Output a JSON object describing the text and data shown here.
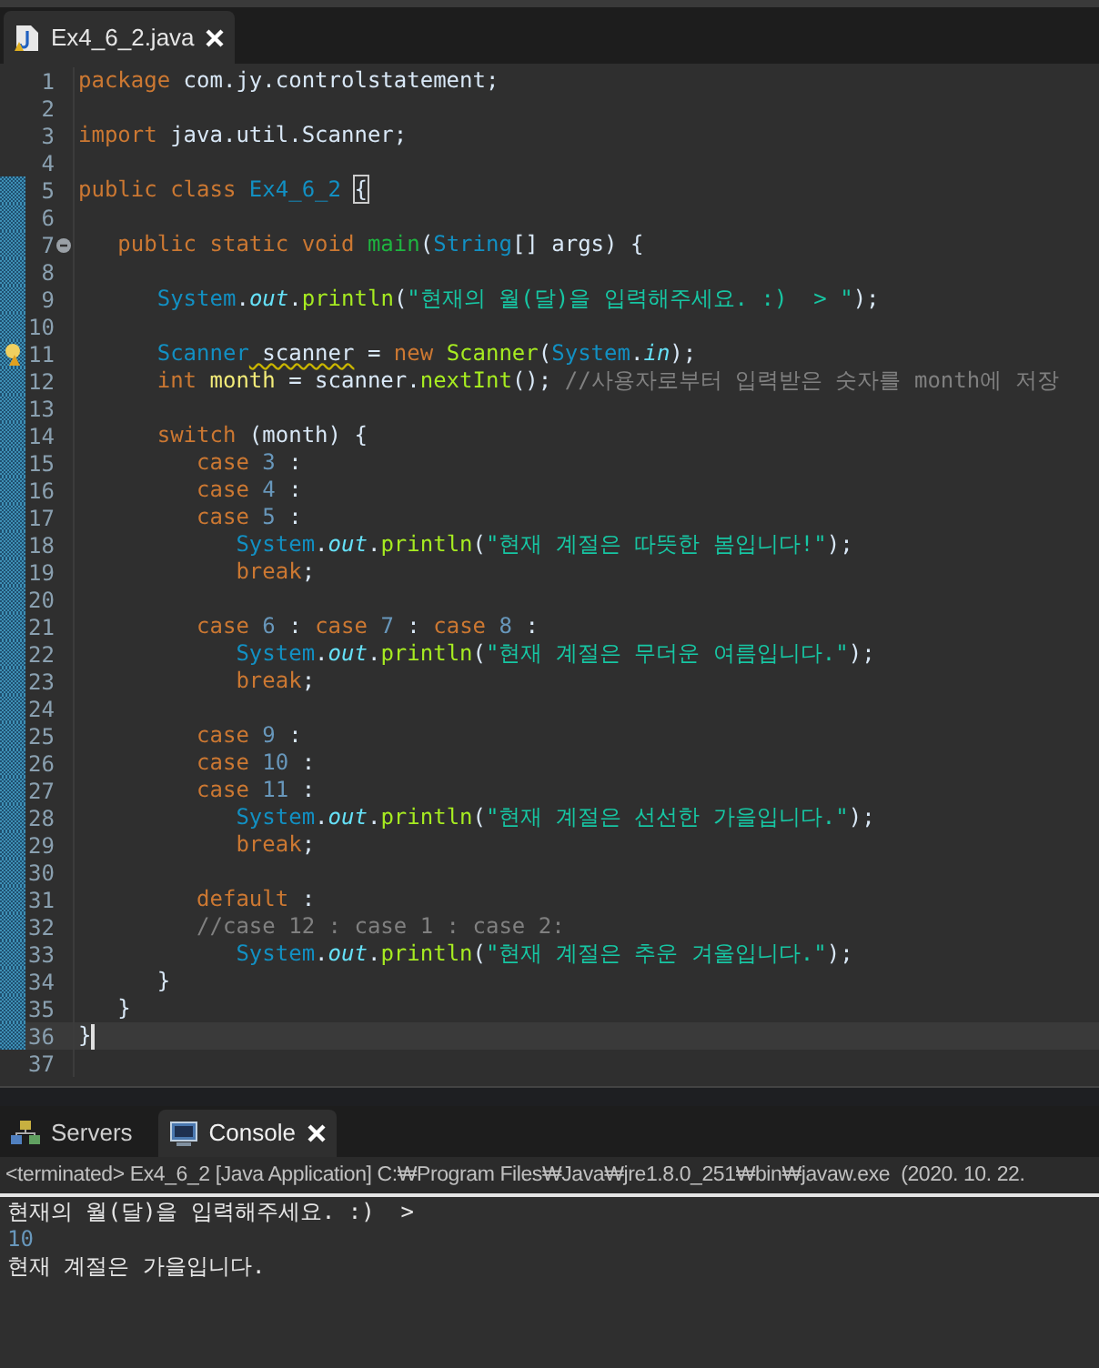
{
  "editor": {
    "tabs": [
      {
        "label": "Ex4_6_2.java",
        "selected": true
      }
    ],
    "lines": [
      {
        "number": "1",
        "kind": "plain",
        "annotated": false,
        "current": false,
        "tokens": [
          {
            "kind": "keyword",
            "text": "package"
          },
          {
            "kind": "plain",
            "text": " com.jy.controlstatement;"
          }
        ]
      },
      {
        "number": "2",
        "kind": "plain",
        "annotated": false,
        "current": false
      },
      {
        "number": "3",
        "kind": "plain",
        "annotated": false,
        "current": false,
        "tokens": [
          {
            "kind": "keyword",
            "text": "import"
          },
          {
            "kind": "plain",
            "text": " java.util.Scanner;"
          }
        ]
      },
      {
        "number": "4",
        "kind": "plain",
        "annotated": false,
        "current": false
      },
      {
        "number": "5",
        "kind": "plain",
        "annotated": true,
        "current": false,
        "tokens": [
          {
            "kind": "keyword",
            "text": "public class "
          },
          {
            "kind": "type",
            "text": "Ex4_6_2 "
          },
          {
            "kind": "bracket",
            "text": "{"
          }
        ]
      },
      {
        "number": "6",
        "kind": "plain",
        "annotated": true,
        "current": false
      },
      {
        "number": "7",
        "kind": "fold",
        "annotated": true,
        "current": false,
        "tokens": [
          {
            "kind": "keyword",
            "text": "   public static void "
          },
          {
            "kind": "method_decl",
            "text": "main"
          },
          {
            "kind": "plain",
            "text": "("
          },
          {
            "kind": "type",
            "text": "String"
          },
          {
            "kind": "plain",
            "text": "[] args) {"
          }
        ]
      },
      {
        "number": "8",
        "kind": "plain",
        "annotated": true,
        "current": false
      },
      {
        "number": "9",
        "kind": "plain",
        "annotated": true,
        "current": false,
        "tokens": [
          {
            "kind": "type",
            "text": "      System"
          },
          {
            "kind": "plain",
            "text": "."
          },
          {
            "kind": "field",
            "text": "out"
          },
          {
            "kind": "plain",
            "text": "."
          },
          {
            "kind": "method",
            "text": "println"
          },
          {
            "kind": "plain",
            "text": "("
          },
          {
            "kind": "string",
            "text": "\"현재의 월(달)을 입력해주세요. :)  > \""
          },
          {
            "kind": "plain",
            "text": ");"
          }
        ]
      },
      {
        "number": "10",
        "kind": "plain",
        "annotated": true,
        "current": false
      },
      {
        "number": "11",
        "kind": "warning",
        "annotated": true,
        "current": false,
        "tokens": [
          {
            "kind": "type",
            "text": "      Scanner"
          },
          {
            "kind": "warning",
            "text": " scanner"
          },
          {
            "kind": "plain",
            "text": " = "
          },
          {
            "kind": "keyword",
            "text": "new "
          },
          {
            "kind": "method",
            "text": "Scanner"
          },
          {
            "kind": "plain",
            "text": "("
          },
          {
            "kind": "type",
            "text": "System"
          },
          {
            "kind": "plain",
            "text": "."
          },
          {
            "kind": "field",
            "text": "in"
          },
          {
            "kind": "plain",
            "text": ");"
          }
        ]
      },
      {
        "number": "12",
        "kind": "plain",
        "annotated": true,
        "current": false,
        "tokens": [
          {
            "kind": "keyword",
            "text": "      int "
          },
          {
            "kind": "variable",
            "text": "month"
          },
          {
            "kind": "plain",
            "text": " = scanner."
          },
          {
            "kind": "method",
            "text": "nextInt"
          },
          {
            "kind": "plain",
            "text": "(); "
          },
          {
            "kind": "comment",
            "text": "//사용자로부터 입력받은 숫자를 month에 저장"
          }
        ]
      },
      {
        "number": "13",
        "kind": "plain",
        "annotated": true,
        "current": false
      },
      {
        "number": "14",
        "kind": "plain",
        "annotated": true,
        "current": false,
        "tokens": [
          {
            "kind": "keyword",
            "text": "      switch"
          },
          {
            "kind": "plain",
            "text": " (month) {"
          }
        ]
      },
      {
        "number": "15",
        "kind": "plain",
        "annotated": true,
        "current": false,
        "tokens": [
          {
            "kind": "keyword",
            "text": "         case "
          },
          {
            "kind": "number",
            "text": "3"
          },
          {
            "kind": "plain",
            "text": " :"
          }
        ]
      },
      {
        "number": "16",
        "kind": "plain",
        "annotated": true,
        "current": false,
        "tokens": [
          {
            "kind": "keyword",
            "text": "         case "
          },
          {
            "kind": "number",
            "text": "4"
          },
          {
            "kind": "plain",
            "text": " :"
          }
        ]
      },
      {
        "number": "17",
        "kind": "plain",
        "annotated": true,
        "current": false,
        "tokens": [
          {
            "kind": "keyword",
            "text": "         case "
          },
          {
            "kind": "number",
            "text": "5"
          },
          {
            "kind": "plain",
            "text": " :"
          }
        ]
      },
      {
        "number": "18",
        "kind": "plain",
        "annotated": true,
        "current": false,
        "tokens": [
          {
            "kind": "type",
            "text": "            System"
          },
          {
            "kind": "plain",
            "text": "."
          },
          {
            "kind": "field",
            "text": "out"
          },
          {
            "kind": "plain",
            "text": "."
          },
          {
            "kind": "method",
            "text": "println"
          },
          {
            "kind": "plain",
            "text": "("
          },
          {
            "kind": "string",
            "text": "\"현재 계절은 따뜻한 봄입니다!\""
          },
          {
            "kind": "plain",
            "text": ");"
          }
        ]
      },
      {
        "number": "19",
        "kind": "plain",
        "annotated": true,
        "current": false,
        "tokens": [
          {
            "kind": "keyword",
            "text": "            break"
          },
          {
            "kind": "plain",
            "text": ";"
          }
        ]
      },
      {
        "number": "20",
        "kind": "plain",
        "annotated": true,
        "current": false
      },
      {
        "number": "21",
        "kind": "plain",
        "annotated": true,
        "current": false,
        "tokens": [
          {
            "kind": "keyword",
            "text": "         case "
          },
          {
            "kind": "number",
            "text": "6"
          },
          {
            "kind": "plain",
            "text": " : "
          },
          {
            "kind": "keyword",
            "text": "case "
          },
          {
            "kind": "number",
            "text": "7"
          },
          {
            "kind": "plain",
            "text": " : "
          },
          {
            "kind": "keyword",
            "text": "case "
          },
          {
            "kind": "number",
            "text": "8"
          },
          {
            "kind": "plain",
            "text": " :"
          }
        ]
      },
      {
        "number": "22",
        "kind": "plain",
        "annotated": true,
        "current": false,
        "tokens": [
          {
            "kind": "type",
            "text": "            System"
          },
          {
            "kind": "plain",
            "text": "."
          },
          {
            "kind": "field",
            "text": "out"
          },
          {
            "kind": "plain",
            "text": "."
          },
          {
            "kind": "method",
            "text": "println"
          },
          {
            "kind": "plain",
            "text": "("
          },
          {
            "kind": "string",
            "text": "\"현재 계절은 무더운 여름입니다.\""
          },
          {
            "kind": "plain",
            "text": ");"
          }
        ]
      },
      {
        "number": "23",
        "kind": "plain",
        "annotated": true,
        "current": false,
        "tokens": [
          {
            "kind": "keyword",
            "text": "            break"
          },
          {
            "kind": "plain",
            "text": ";"
          }
        ]
      },
      {
        "number": "24",
        "kind": "plain",
        "annotated": true,
        "current": false
      },
      {
        "number": "25",
        "kind": "plain",
        "annotated": true,
        "current": false,
        "tokens": [
          {
            "kind": "keyword",
            "text": "         case "
          },
          {
            "kind": "number",
            "text": "9"
          },
          {
            "kind": "plain",
            "text": " :"
          }
        ]
      },
      {
        "number": "26",
        "kind": "plain",
        "annotated": true,
        "current": false,
        "tokens": [
          {
            "kind": "keyword",
            "text": "         case "
          },
          {
            "kind": "number",
            "text": "10"
          },
          {
            "kind": "plain",
            "text": " :"
          }
        ]
      },
      {
        "number": "27",
        "kind": "plain",
        "annotated": true,
        "current": false,
        "tokens": [
          {
            "kind": "keyword",
            "text": "         case "
          },
          {
            "kind": "number",
            "text": "11"
          },
          {
            "kind": "plain",
            "text": " :"
          }
        ]
      },
      {
        "number": "28",
        "kind": "plain",
        "annotated": true,
        "current": false,
        "tokens": [
          {
            "kind": "type",
            "text": "            System"
          },
          {
            "kind": "plain",
            "text": "."
          },
          {
            "kind": "field",
            "text": "out"
          },
          {
            "kind": "plain",
            "text": "."
          },
          {
            "kind": "method",
            "text": "println"
          },
          {
            "kind": "plain",
            "text": "("
          },
          {
            "kind": "string",
            "text": "\"현재 계절은 선선한 가을입니다.\""
          },
          {
            "kind": "plain",
            "text": ");"
          }
        ]
      },
      {
        "number": "29",
        "kind": "plain",
        "annotated": true,
        "current": false,
        "tokens": [
          {
            "kind": "keyword",
            "text": "            break"
          },
          {
            "kind": "plain",
            "text": ";"
          }
        ]
      },
      {
        "number": "30",
        "kind": "plain",
        "annotated": true,
        "current": false
      },
      {
        "number": "31",
        "kind": "plain",
        "annotated": true,
        "current": false,
        "tokens": [
          {
            "kind": "keyword",
            "text": "         default"
          },
          {
            "kind": "plain",
            "text": " :"
          }
        ]
      },
      {
        "number": "32",
        "kind": "plain",
        "annotated": true,
        "current": false,
        "tokens": [
          {
            "kind": "comment",
            "text": "         //case 12 : case 1 : case 2:"
          }
        ]
      },
      {
        "number": "33",
        "kind": "plain",
        "annotated": true,
        "current": false,
        "tokens": [
          {
            "kind": "type",
            "text": "            System"
          },
          {
            "kind": "plain",
            "text": "."
          },
          {
            "kind": "field",
            "text": "out"
          },
          {
            "kind": "plain",
            "text": "."
          },
          {
            "kind": "method",
            "text": "println"
          },
          {
            "kind": "plain",
            "text": "("
          },
          {
            "kind": "string",
            "text": "\"현재 계절은 추운 겨울입니다.\""
          },
          {
            "kind": "plain",
            "text": ");"
          }
        ]
      },
      {
        "number": "34",
        "kind": "plain",
        "annotated": true,
        "current": false,
        "tokens": [
          {
            "kind": "plain",
            "text": "      }"
          }
        ]
      },
      {
        "number": "35",
        "kind": "plain",
        "annotated": true,
        "current": false,
        "tokens": [
          {
            "kind": "plain",
            "text": "   }"
          }
        ]
      },
      {
        "number": "36",
        "kind": "plain",
        "annotated": true,
        "current": true,
        "tokens": [
          {
            "kind": "plain",
            "text": "}"
          }
        ]
      },
      {
        "number": "37",
        "kind": "plain",
        "annotated": false,
        "current": false
      }
    ]
  },
  "bottom_panel": {
    "tabs": [
      {
        "label": "Servers",
        "selected": false
      },
      {
        "label": "Console",
        "selected": true
      }
    ],
    "console_header": "<terminated> Ex4_6_2 [Java Application] C:₩Program Files₩Java₩jre1.8.0_251₩bin₩javaw.exe  (2020. 10. 22.",
    "output": [
      {
        "kind": "output",
        "text": "현재의 월(달)을 입력해주세요. :)  >"
      },
      {
        "kind": "input",
        "text": "10"
      },
      {
        "kind": "output",
        "text": "현재 계절은 가을입니다."
      }
    ]
  }
}
